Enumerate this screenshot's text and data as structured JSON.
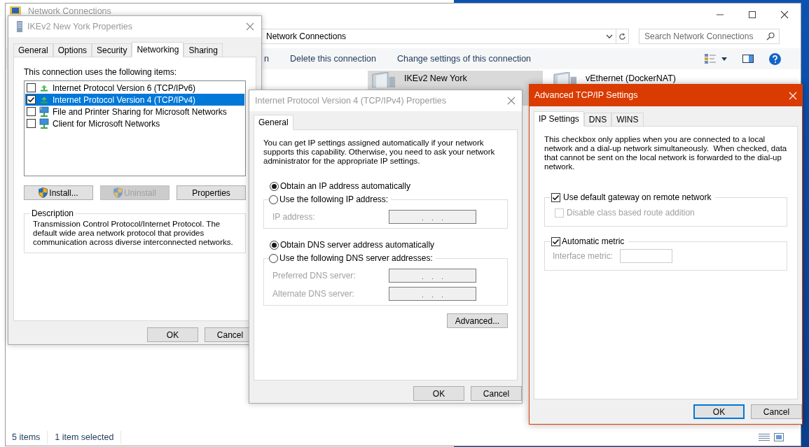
{
  "explorer": {
    "title": "Network Connections",
    "address": "Network Connections",
    "search": {
      "placeholder": "Search Network Connections"
    },
    "toolbar": [
      "n",
      "Delete this connection",
      "Change settings of this connection"
    ],
    "items": [
      {
        "name": "IKEv2 New York",
        "selected": true
      },
      {
        "name": "vEthernet (DockerNAT)",
        "selected": false
      }
    ],
    "status_bar": [
      "5 items",
      "1 item selected"
    ]
  },
  "connection_properties": {
    "title": "IKEv2 New York Properties",
    "tabs": [
      {
        "label": "General",
        "selected": false
      },
      {
        "label": "Options",
        "selected": false
      },
      {
        "label": "Security",
        "selected": false
      },
      {
        "label": "Networking",
        "selected": true
      },
      {
        "label": "Sharing",
        "selected": false
      }
    ],
    "list_label": "This connection uses the following items:",
    "items": [
      {
        "label": "Internet Protocol Version 6 (TCP/IPv6)",
        "checked": false,
        "selected": false,
        "kind": "protocol"
      },
      {
        "label": "Internet Protocol Version 4 (TCP/IPv4)",
        "checked": true,
        "selected": true,
        "kind": "protocol"
      },
      {
        "label": "File and Printer Sharing for Microsoft Networks",
        "checked": false,
        "selected": false,
        "kind": "service"
      },
      {
        "label": "Client for Microsoft Networks",
        "checked": false,
        "selected": false,
        "kind": "client"
      }
    ],
    "buttons": [
      {
        "label": "Install...",
        "disabled": false,
        "kind": "shield"
      },
      {
        "label": "Uninstall",
        "disabled": true,
        "kind": "shield"
      },
      {
        "label": "Properties",
        "disabled": false,
        "kind": "plain"
      }
    ],
    "description": {
      "legend": "Description",
      "text": "Transmission Control Protocol/Internet Protocol. The default wide area network protocol that provides communication across diverse interconnected networks."
    },
    "footer": [
      "OK",
      "Cancel"
    ]
  },
  "ipv4_properties": {
    "title": "Internet Protocol Version 4 (TCP/IPv4) Properties",
    "tabs": [
      {
        "label": "General",
        "selected": true
      }
    ],
    "intro": "You can get IP settings assigned automatically if your network supports this capability. Otherwise, you need to ask your network administrator for the appropriate IP settings.",
    "sections": [
      {
        "auto": {
          "label": "Obtain an IP address automatically",
          "selected": true
        },
        "manual": {
          "label": "Use the following IP address:",
          "selected": false
        },
        "fields": [
          {
            "label": "IP address:",
            "disabled": true
          }
        ]
      },
      {
        "auto": {
          "label": "Obtain DNS server address automatically",
          "selected": true
        },
        "manual": {
          "label": "Use the following DNS server addresses:",
          "selected": false
        },
        "fields": [
          {
            "label": "Preferred DNS server:",
            "disabled": true
          },
          {
            "label": "Alternate DNS server:",
            "disabled": true
          }
        ]
      }
    ],
    "advanced_button": "Advanced...",
    "footer": [
      "OK",
      "Cancel"
    ]
  },
  "advanced_tcpip": {
    "title": "Advanced TCP/IP Settings",
    "tabs": [
      {
        "label": "IP Settings",
        "selected": true
      },
      {
        "label": "DNS",
        "selected": false
      },
      {
        "label": "WINS",
        "selected": false
      }
    ],
    "intro": "This checkbox only applies when you are connected to a local network and a dial-up network simultaneously.  When checked, data that cannot be sent on the local network is forwarded to the dial-up network.",
    "gateway": {
      "label": "Use default gateway on remote network",
      "checked": true,
      "disabled": false
    },
    "class_route": {
      "label": "Disable class based route addition",
      "checked": false,
      "disabled": true
    },
    "metric": {
      "label": "Automatic metric",
      "checked": true,
      "disabled": false
    },
    "interface_metric": {
      "label": "Interface metric:",
      "disabled": true
    },
    "footer": [
      {
        "label": "OK",
        "focused": true
      },
      {
        "label": "Cancel",
        "focused": false
      }
    ]
  }
}
